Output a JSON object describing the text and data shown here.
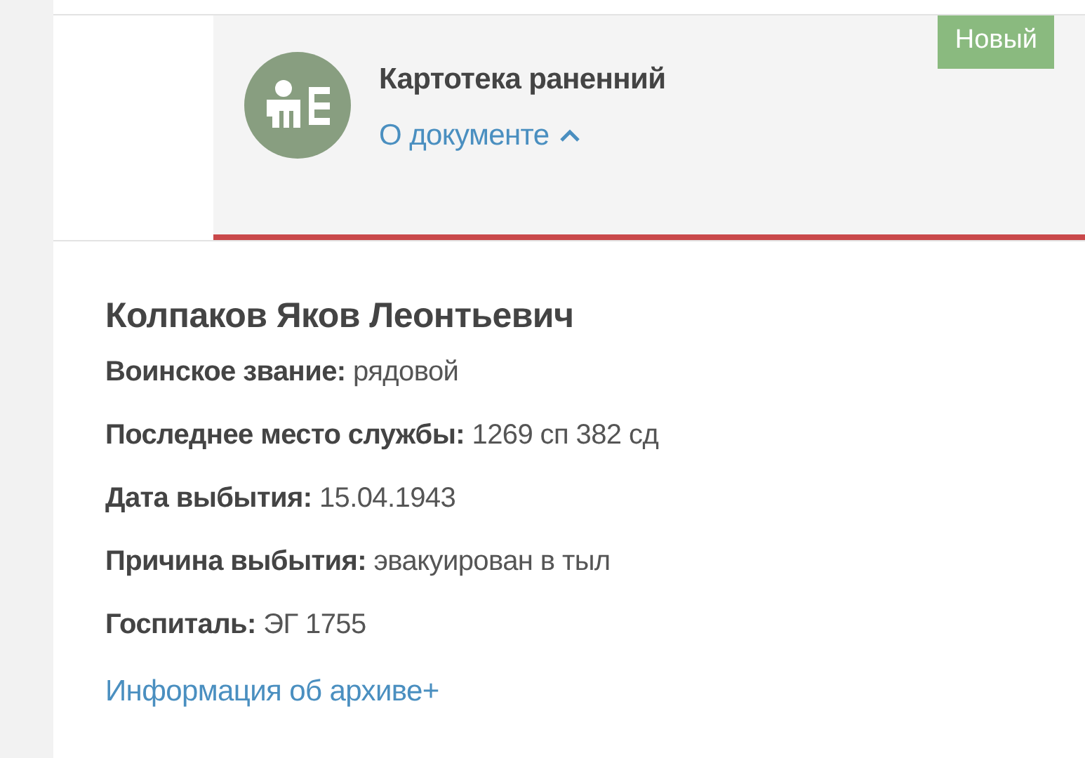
{
  "document_card": {
    "title": "Картотека раненний",
    "about_link": {
      "label": "О документе",
      "expanded": true
    },
    "badge": "Новый"
  },
  "person": {
    "name": "Колпаков Яков Леонтьевич",
    "fields": [
      {
        "text": "**Воинское звание:** рядовой"
      },
      {
        "text": "**Последнее место службы:** 1269 сп 382 сд"
      },
      {
        "text": "**Дата выбытия:** 15.04.1943"
      },
      {
        "text": "**Причина выбытия:** эвакуирован в тыл"
      },
      {
        "text": "**Госпиталь:** ЭГ 1755"
      }
    ],
    "archive_link": "Информация об архиве+"
  }
}
